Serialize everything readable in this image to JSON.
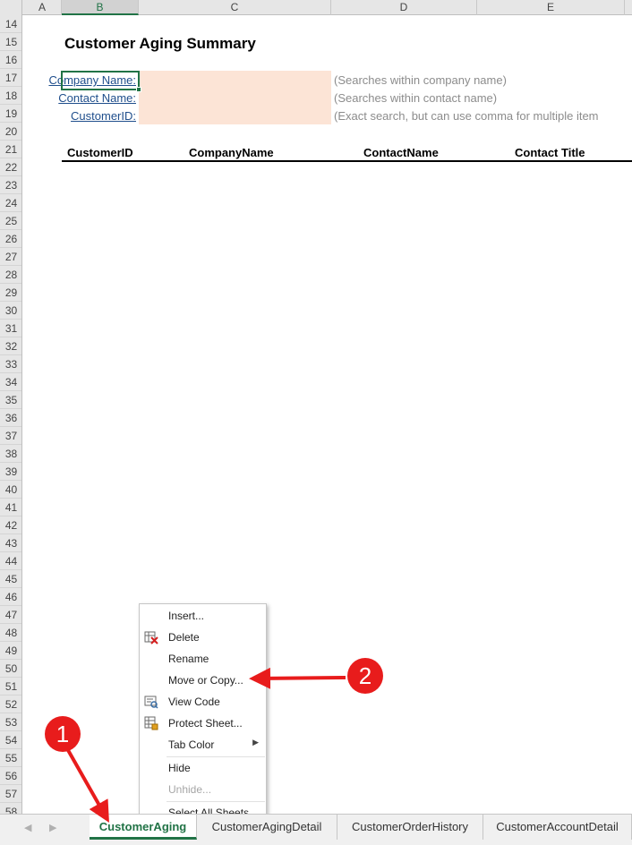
{
  "columns": [
    {
      "letter": "A"
    },
    {
      "letter": "B"
    },
    {
      "letter": "C"
    },
    {
      "letter": "D"
    },
    {
      "letter": "E"
    }
  ],
  "rows": [
    "14",
    "15",
    "16",
    "17",
    "18",
    "19",
    "20",
    "21",
    "22",
    "23",
    "24",
    "25",
    "26",
    "27",
    "28",
    "29",
    "30",
    "31",
    "32",
    "33",
    "34",
    "35",
    "36",
    "37",
    "38",
    "39",
    "40",
    "41",
    "42",
    "43",
    "44",
    "45",
    "46",
    "47",
    "48",
    "49",
    "50",
    "51",
    "52",
    "53",
    "54",
    "55",
    "56",
    "57",
    "58"
  ],
  "sheet": {
    "title": "Customer Aging Summary",
    "filters": [
      {
        "label": "Company Name:",
        "value": "",
        "hint": "(Searches within company name)"
      },
      {
        "label": "Contact Name:",
        "value": "",
        "hint": "(Searches within contact name)"
      },
      {
        "label": "CustomerID:",
        "value": "",
        "hint": "(Exact search, but can use comma for multiple item"
      }
    ],
    "table_headers": [
      "CustomerID",
      "CompanyName",
      "ContactName",
      "Contact Title"
    ]
  },
  "context_menu": {
    "items": [
      {
        "label": "Insert...",
        "icon": "",
        "enabled": true
      },
      {
        "label": "Delete",
        "icon": "delete-sheet-icon",
        "enabled": true
      },
      {
        "label": "Rename",
        "icon": "",
        "enabled": true
      },
      {
        "label": "Move or Copy...",
        "icon": "",
        "enabled": true
      },
      {
        "label": "View Code",
        "icon": "view-code-icon",
        "enabled": true
      },
      {
        "label": "Protect Sheet...",
        "icon": "protect-sheet-icon",
        "enabled": true
      },
      {
        "label": "Tab Color",
        "icon": "",
        "enabled": true,
        "submenu": true
      },
      {
        "label": "Hide",
        "icon": "",
        "enabled": true
      },
      {
        "label": "Unhide...",
        "icon": "",
        "enabled": false
      },
      {
        "label": "Select All Sheets",
        "icon": "",
        "enabled": true
      }
    ]
  },
  "tabs": [
    {
      "label": "CustomerAging",
      "active": true
    },
    {
      "label": "CustomerAgingDetail",
      "active": false
    },
    {
      "label": "CustomerOrderHistory",
      "active": false
    },
    {
      "label": "CustomerAccountDetail",
      "active": false
    }
  ],
  "callouts": [
    "1",
    "2"
  ],
  "colors": {
    "accent": "#217346",
    "input_fill": "#fce4d6",
    "callout": "#e81c1c",
    "link": "#1f4e8c"
  }
}
